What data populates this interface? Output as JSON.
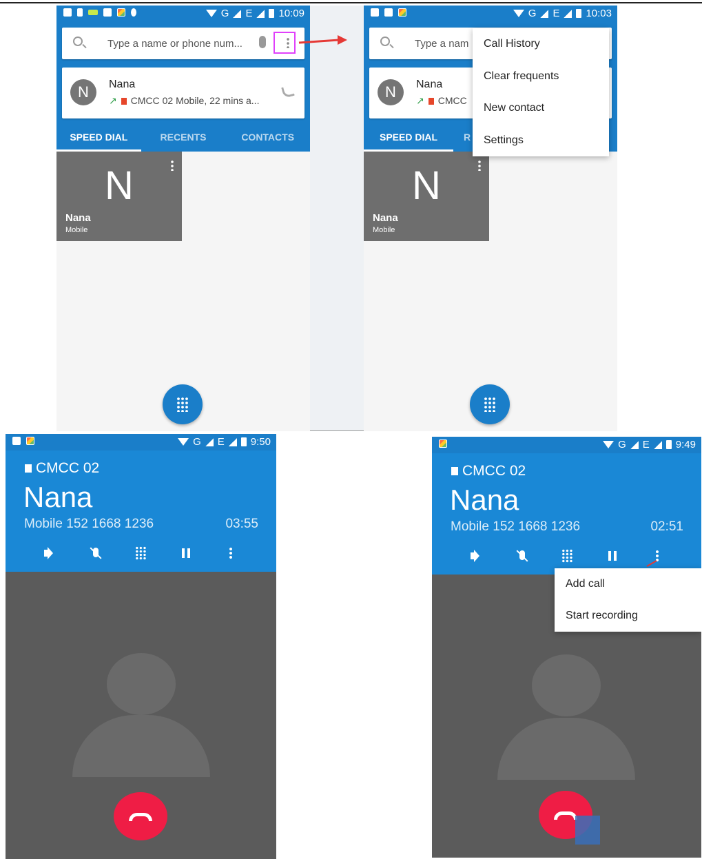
{
  "dialer": {
    "status_time_1": "10:09",
    "status_time_2": "10:03",
    "status_net": "G",
    "status_net2": "E",
    "search_placeholder": "Type a name or phone num...",
    "search_placeholder_short": "Type a nam",
    "recent": {
      "avatar_letter": "N",
      "name": "Nana",
      "sub": "CMCC 02 Mobile, 22 mins a...",
      "sub_short": "CMCC"
    },
    "tabs": [
      "SPEED DIAL",
      "RECENTS",
      "CONTACTS"
    ],
    "tab_short_2": "R",
    "speed_tile": {
      "letter": "N",
      "name": "Nana",
      "type": "Mobile"
    },
    "overflow_menu": [
      "Call History",
      "Clear frequents",
      "New contact",
      "Settings"
    ]
  },
  "call": {
    "status_time_1": "9:50",
    "status_time_2": "9:49",
    "sim": "CMCC 02",
    "name": "Nana",
    "number": "Mobile 152 1668 1236",
    "duration_1": "03:55",
    "duration_2": "02:51",
    "more_menu": [
      "Add call",
      "Start recording"
    ]
  },
  "colors": {
    "header_blue": "#1a7ec9",
    "end_call_red": "#ef1d45",
    "highlight_magenta": "#e040fb",
    "annotation_red": "#e53935"
  }
}
